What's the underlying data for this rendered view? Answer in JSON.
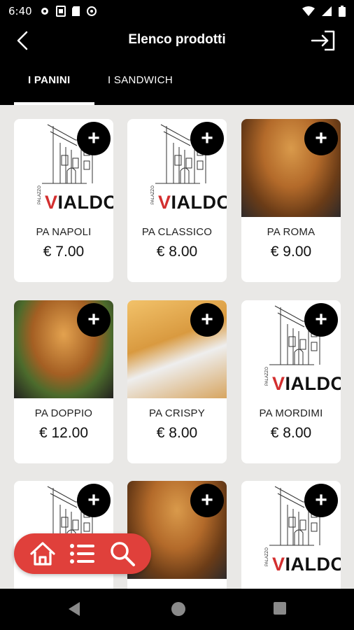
{
  "status": {
    "time": "6:40"
  },
  "appbar": {
    "title": "Elenco prodotti"
  },
  "tabs": [
    {
      "label": "I PANINI",
      "active": true
    },
    {
      "label": "I SANDWICH",
      "active": false
    }
  ],
  "products": [
    {
      "name": "PA NAPOLI",
      "price": "€ 7.00",
      "image": "logo"
    },
    {
      "name": "PA CLASSICO",
      "price": "€ 8.00",
      "image": "logo"
    },
    {
      "name": "PA ROMA",
      "price": "€ 9.00",
      "image": "photo"
    },
    {
      "name": "PA DOPPIO",
      "price": "€ 12.00",
      "image": "photo"
    },
    {
      "name": "PA CRISPY",
      "price": "€ 8.00",
      "image": "photo"
    },
    {
      "name": "PA MORDIMI",
      "price": "€ 8.00",
      "image": "logo"
    },
    {
      "name": "",
      "price": "",
      "image": "logo"
    },
    {
      "name": "",
      "price": "",
      "image": "photo"
    },
    {
      "name": "",
      "price": "",
      "image": "logo"
    }
  ],
  "logo_text": "VIALDO",
  "logo_small": "PALAZZO",
  "add_label": "+",
  "colors": {
    "accent": "#e0403b",
    "bar": "#000000",
    "background": "#e9e8e6"
  },
  "icons": [
    "back-arrow-icon",
    "logout-icon",
    "home-icon",
    "list-icon",
    "search-icon"
  ]
}
